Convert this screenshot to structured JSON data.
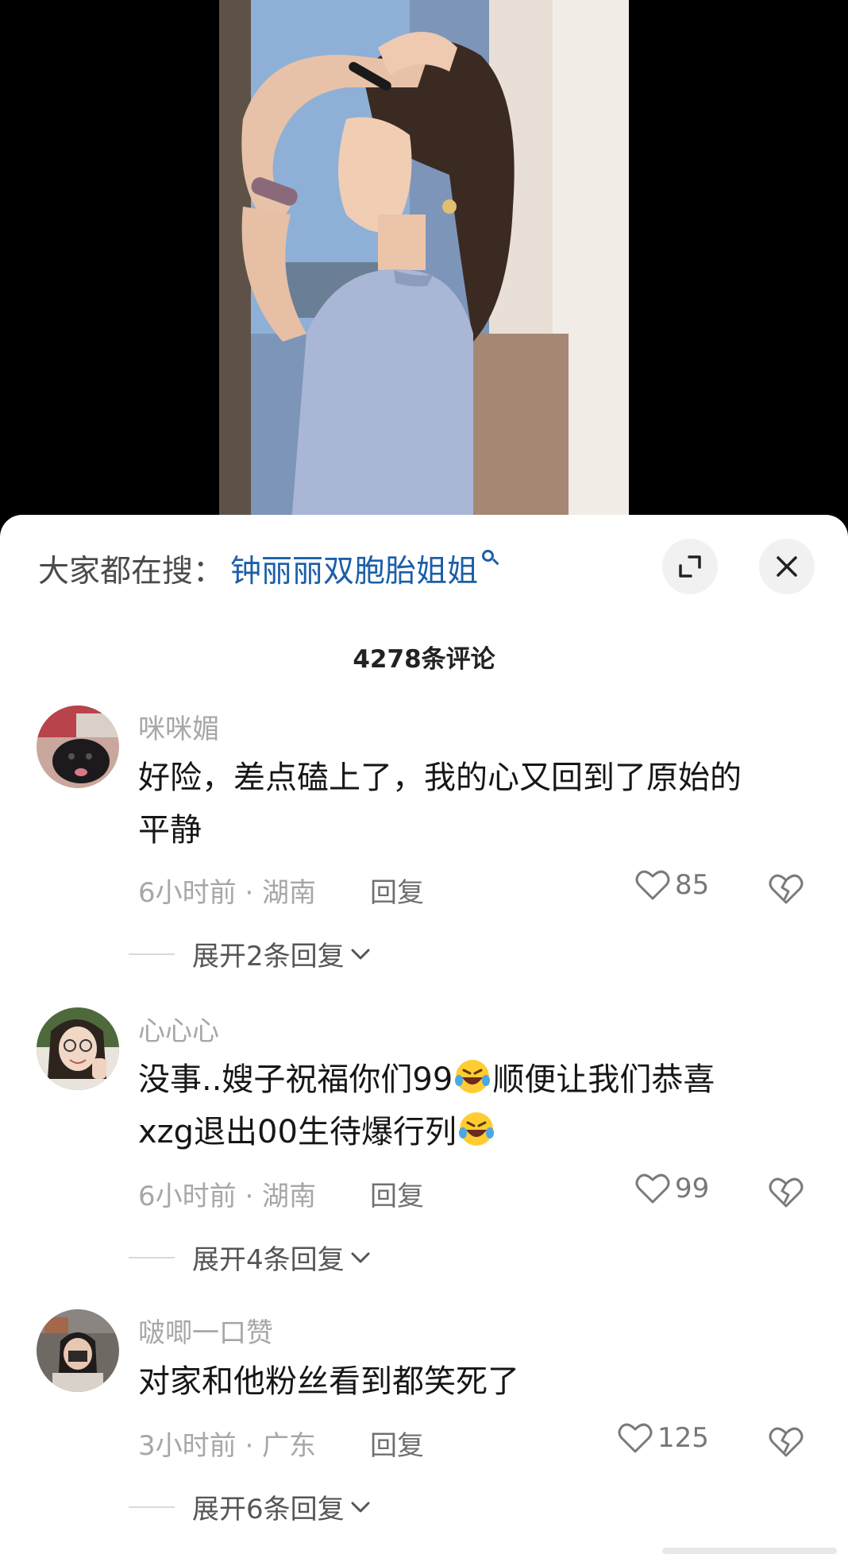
{
  "search": {
    "prefix": "大家都在搜：",
    "term": "钟丽丽双胞胎姐姐",
    "icon": "search-icon"
  },
  "header": {
    "comment_count": "4278条评论",
    "expand_icon": "expand-icon",
    "close_icon": "close-icon"
  },
  "comments": [
    {
      "username": "咪咪媚",
      "text_lines": [
        "好险，差点磕上了，我的心又回到了原始的",
        "平静"
      ],
      "time_location": "6小时前 · 湖南",
      "reply_label": "回复",
      "likes": "85",
      "expand_label": "展开2条回复"
    },
    {
      "username": "心心心",
      "text_line1_a": "没事..嫂子祝福你们99",
      "text_line1_b": "顺便让我们恭喜",
      "text_line2": "xzg退出00生待爆行列",
      "emoji": "rofl-emoji",
      "time_location": "6小时前 · 湖南",
      "reply_label": "回复",
      "likes": "99",
      "expand_label": "展开4条回复"
    },
    {
      "username": "啵唧一口赞",
      "text_lines": [
        "对家和他粉丝看到都笑死了"
      ],
      "time_location": "3小时前 · 广东",
      "reply_label": "回复",
      "likes": "125",
      "expand_label": "展开6条回复"
    }
  ],
  "colors": {
    "link_blue": "#1c5fa8",
    "meta_gray": "#a7a7a7",
    "text": "#161616",
    "sheet_bg": "#ffffff",
    "video_bg": "#000000"
  }
}
